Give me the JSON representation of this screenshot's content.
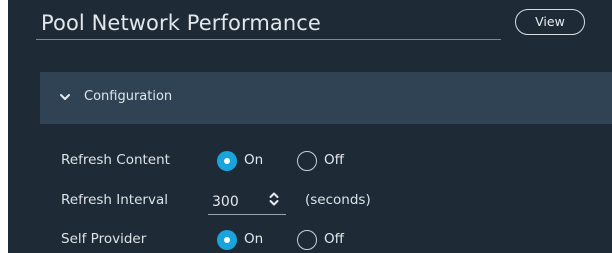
{
  "header": {
    "title": "Pool Network Performance",
    "view_button_label": "View"
  },
  "configuration": {
    "section_label": "Configuration",
    "expanded": true,
    "rows": {
      "refresh_content": {
        "label": "Refresh Content",
        "options": [
          "On",
          "Off"
        ],
        "selected": "On"
      },
      "refresh_interval": {
        "label": "Refresh Interval",
        "value": "300",
        "units": "(seconds)"
      },
      "self_provider": {
        "label": "Self Provider",
        "options": [
          "On",
          "Off"
        ],
        "selected": "On"
      }
    }
  },
  "icons": {
    "section_toggle": "chevron-down-icon",
    "stepper": "up-down-stepper-icon"
  },
  "colors": {
    "background": "#1e2b37",
    "section_header": "#2f4354",
    "accent": "#1aa4de",
    "text": "#e3e7ea"
  }
}
